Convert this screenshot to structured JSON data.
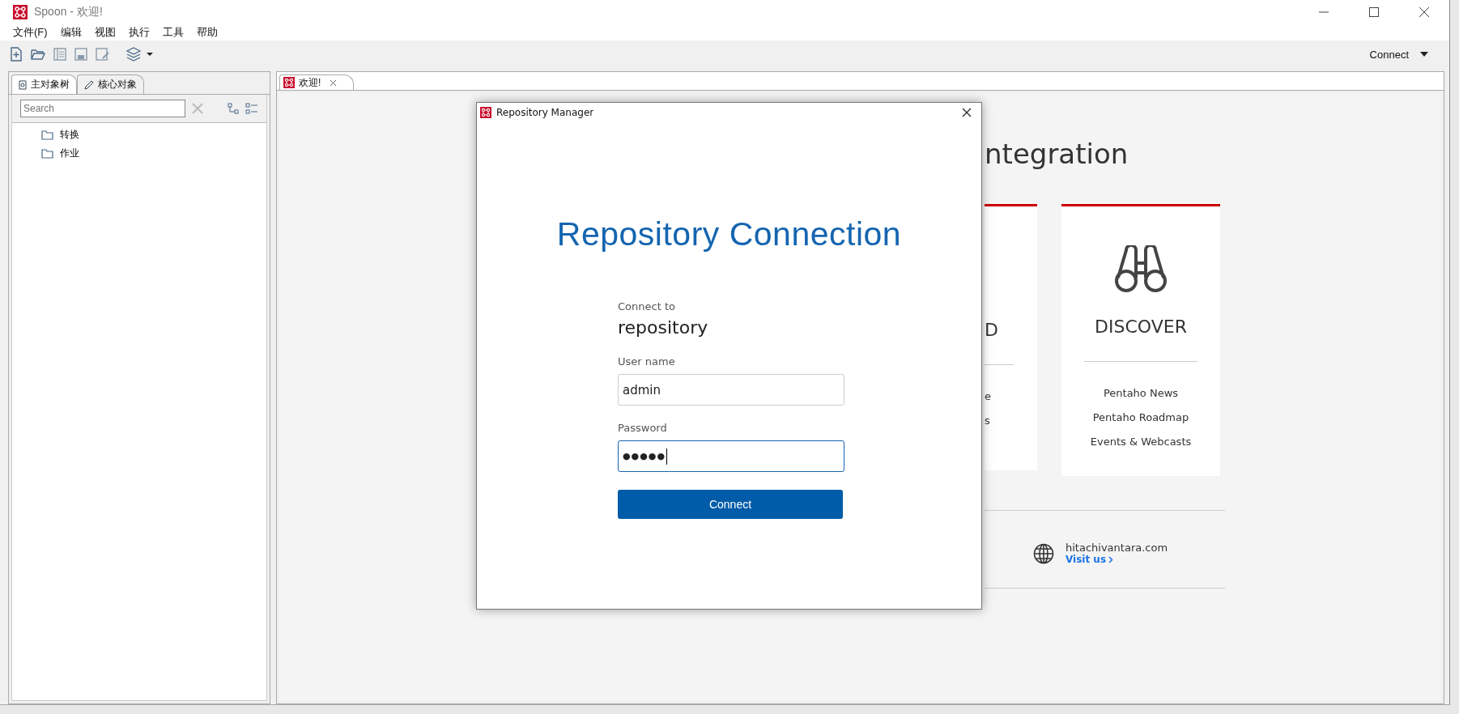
{
  "window": {
    "title": "Spoon - 欢迎!"
  },
  "menu": [
    "文件(F)",
    "编辑",
    "视图",
    "执行",
    "工具",
    "帮助"
  ],
  "toolbar": {
    "connect_label": "Connect"
  },
  "left_panel": {
    "tabs": [
      {
        "label": "主对象树",
        "selected": true
      },
      {
        "label": "核心对象",
        "selected": false
      }
    ],
    "search": {
      "placeholder": "Search"
    },
    "tree": [
      {
        "label": "转换"
      },
      {
        "label": "作业"
      }
    ]
  },
  "editor_tabs": [
    {
      "label": "欢迎!",
      "selected": true
    }
  ],
  "welcome": {
    "heading": "ntegration",
    "cards": [
      {
        "title": "D",
        "links": [
          "e",
          "s"
        ]
      },
      {
        "title": "DISCOVER",
        "links": [
          "Pentaho News",
          "Pentaho Roadmap",
          "Events & Webcasts"
        ]
      }
    ],
    "site": "hitachivantara.com",
    "visit": "Visit us"
  },
  "dialog": {
    "title": "Repository Manager",
    "heading": "Repository Connection",
    "connect_to_label": "Connect to",
    "repository": "repository",
    "fields": [
      {
        "label": "User name",
        "value": "admin",
        "focused": false
      },
      {
        "label": "Password",
        "value": "●●●●●",
        "focused": true
      }
    ],
    "button": "Connect"
  }
}
